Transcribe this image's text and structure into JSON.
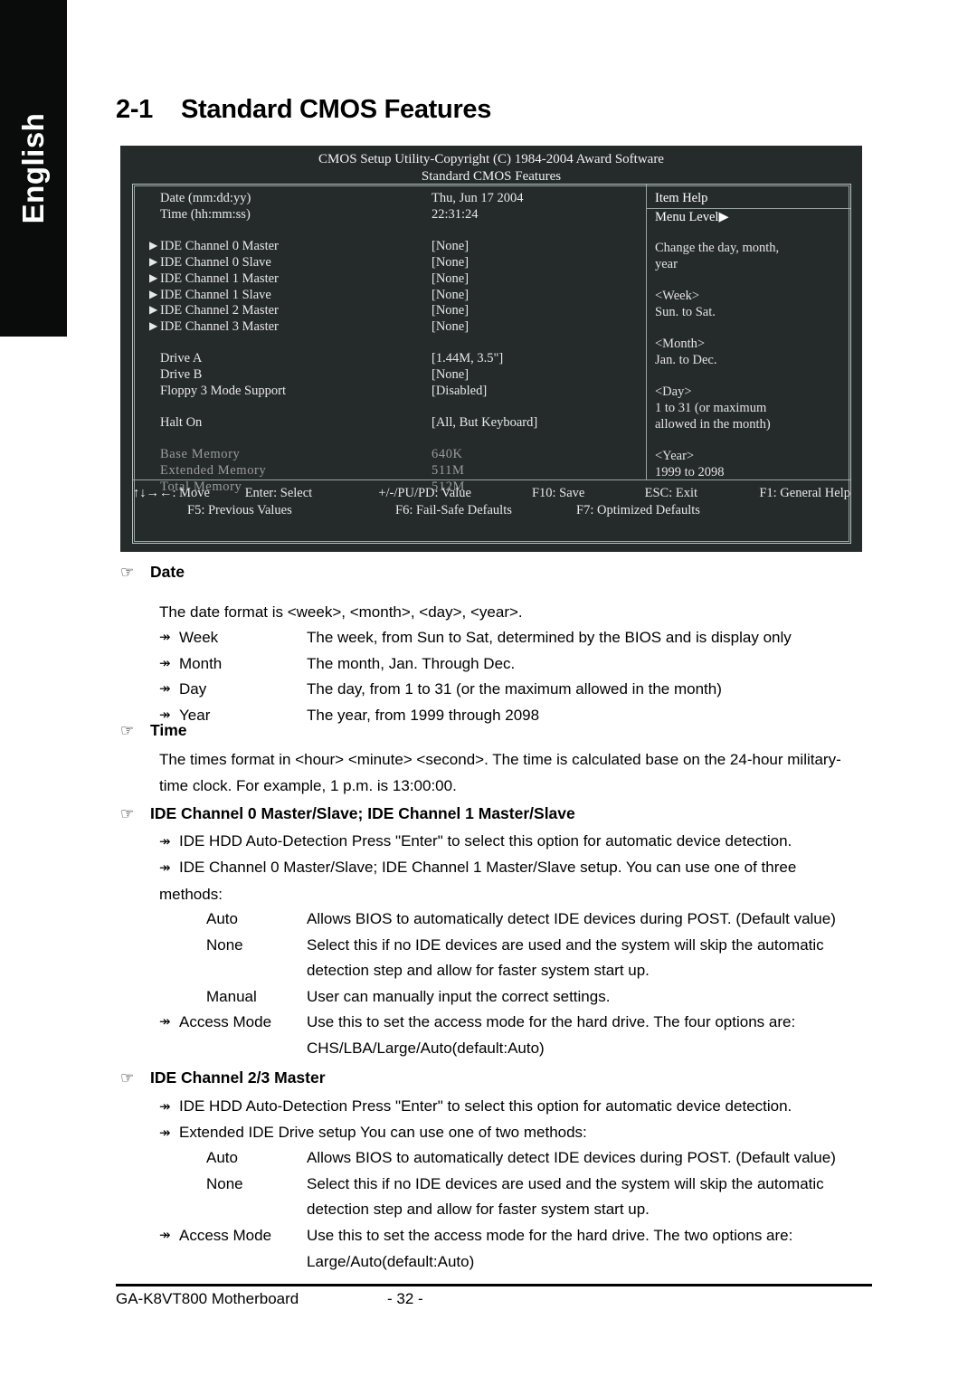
{
  "sidebar": {
    "language_tab": "English"
  },
  "heading": {
    "number": "2-1",
    "title": "Standard CMOS Features"
  },
  "bios": {
    "title_line1": "CMOS Setup Utility-Copyright (C) 1984-2004 Award Software",
    "title_line2": "Standard CMOS Features",
    "arrow_glyph": "▶",
    "rows": [
      {
        "arrow": "",
        "label": "Date (mm:dd:yy)",
        "value": "Thu, Jun  17  2004"
      },
      {
        "arrow": "",
        "label": "Time (hh:mm:ss)",
        "value": "22:31:24"
      },
      {
        "gap": true
      },
      {
        "arrow": "▶",
        "label": "IDE Channel 0 Master",
        "value": "[None]"
      },
      {
        "arrow": "▶",
        "label": "IDE Channel 0 Slave",
        "value": "[None]"
      },
      {
        "arrow": "▶",
        "label": "IDE Channel 1 Master",
        "value": "[None]"
      },
      {
        "arrow": "▶",
        "label": "IDE Channel 1 Slave",
        "value": "[None]"
      },
      {
        "arrow": "▶",
        "label": "IDE Channel 2 Master",
        "value": "[None]"
      },
      {
        "arrow": "▶",
        "label": "IDE Channel 3 Master",
        "value": "[None]"
      },
      {
        "gap": true
      },
      {
        "arrow": "",
        "label": "Drive A",
        "value": "[1.44M, 3.5\"]"
      },
      {
        "arrow": "",
        "label": "Drive B",
        "value": "[None]"
      },
      {
        "arrow": "",
        "label": "Floppy 3 Mode Support",
        "value": "[Disabled]"
      },
      {
        "gap": true
      },
      {
        "arrow": "",
        "label": "Halt On",
        "value": "[All, But Keyboard]"
      },
      {
        "gap": true
      },
      {
        "arrow": "",
        "label": "Base Memory",
        "value": "640K",
        "dim": true
      },
      {
        "arrow": "",
        "label": "Extended Memory",
        "value": "511M",
        "dim": true
      },
      {
        "arrow": "",
        "label": "Total Memory",
        "value": "512M",
        "dim": true
      }
    ],
    "help": {
      "header": "Item Help",
      "menu_level": "Menu Level",
      "menu_level_arrow": "▶",
      "blocks": [
        [
          "Change the day, month,",
          "year"
        ],
        [
          "<Week>",
          "Sun. to Sat."
        ],
        [
          "<Month>",
          "Jan. to Dec."
        ],
        [
          "<Day>",
          "1 to 31 (or maximum",
          "allowed in the month)"
        ],
        [
          "<Year>",
          "1999 to 2098"
        ]
      ]
    },
    "keys_row1": [
      "↑↓→←: Move",
      "Enter: Select",
      "+/-/PU/PD: Value",
      "F10: Save",
      "ESC: Exit",
      "F1: General Help"
    ],
    "keys_row2": [
      "F5: Previous Values",
      "F6: Fail-Safe Defaults",
      "F7: Optimized Defaults"
    ]
  },
  "sections": {
    "hand_glyph": "☞",
    "bullet_glyph": "↠",
    "date": {
      "heading": "Date",
      "intro": "The date format is <week>, <month>, <day>, <year>.",
      "rows": [
        {
          "term": "Week",
          "desc": "The week, from Sun to Sat, determined by the BIOS and is display only"
        },
        {
          "term": "Month",
          "desc": "The month, Jan. Through Dec."
        },
        {
          "term": "Day",
          "desc": "The day, from 1 to 31 (or the maximum allowed in the month)"
        },
        {
          "term": "Year",
          "desc": "The year, from 1999 through 2098"
        }
      ]
    },
    "time": {
      "heading": "Time",
      "line1": "The times format in <hour> <minute> <second>. The time is calculated base on the 24-hour military-",
      "line2": "time clock. For example, 1 p.m. is 13:00:00."
    },
    "ide01": {
      "heading": "IDE Channel 0 Master/Slave; IDE Channel 1 Master/Slave",
      "bullet1": "IDE HDD Auto-Detection Press \"Enter\" to select this option for automatic device detection.",
      "bullet2_line1": "IDE Channel 0 Master/Slave; IDE Channel 1 Master/Slave setup.  You can use one of three",
      "bullet2_line2": "methods:",
      "methods": [
        {
          "term": "Auto",
          "desc": "Allows BIOS to automatically detect IDE devices during POST. (Default value)"
        },
        {
          "term": "None",
          "desc": "Select this if no IDE devices are used and the system will skip the automatic"
        },
        {
          "term": "",
          "desc": "detection step and allow for faster system start up."
        },
        {
          "term": "Manual",
          "desc": "User can manually input the correct settings."
        }
      ],
      "access_term": "Access Mode",
      "access_line1": "Use this to set the access mode for the hard drive. The four options are:",
      "access_line2": "CHS/LBA/Large/Auto(default:Auto)"
    },
    "ide23": {
      "heading": "IDE Channel 2/3 Master",
      "bullet1": "IDE HDD Auto-Detection Press \"Enter\" to select this option for automatic device detection.",
      "bullet2": "Extended IDE Drive setup  You can use one of two methods:",
      "methods": [
        {
          "term": "Auto",
          "desc": "Allows BIOS to automatically detect IDE devices during POST. (Default value)"
        },
        {
          "term": "None",
          "desc": "Select this if no IDE devices are used and the system will skip the automatic"
        },
        {
          "term": "",
          "desc": "detection step and allow for faster system start up."
        }
      ],
      "access_term": "Access Mode",
      "access_line1": "Use this to set the access mode for the hard drive. The two options are:",
      "access_line2": "Large/Auto(default:Auto)"
    }
  },
  "footer": {
    "left": "GA-K8VT800 Motherboard",
    "center": "- 32 -"
  }
}
